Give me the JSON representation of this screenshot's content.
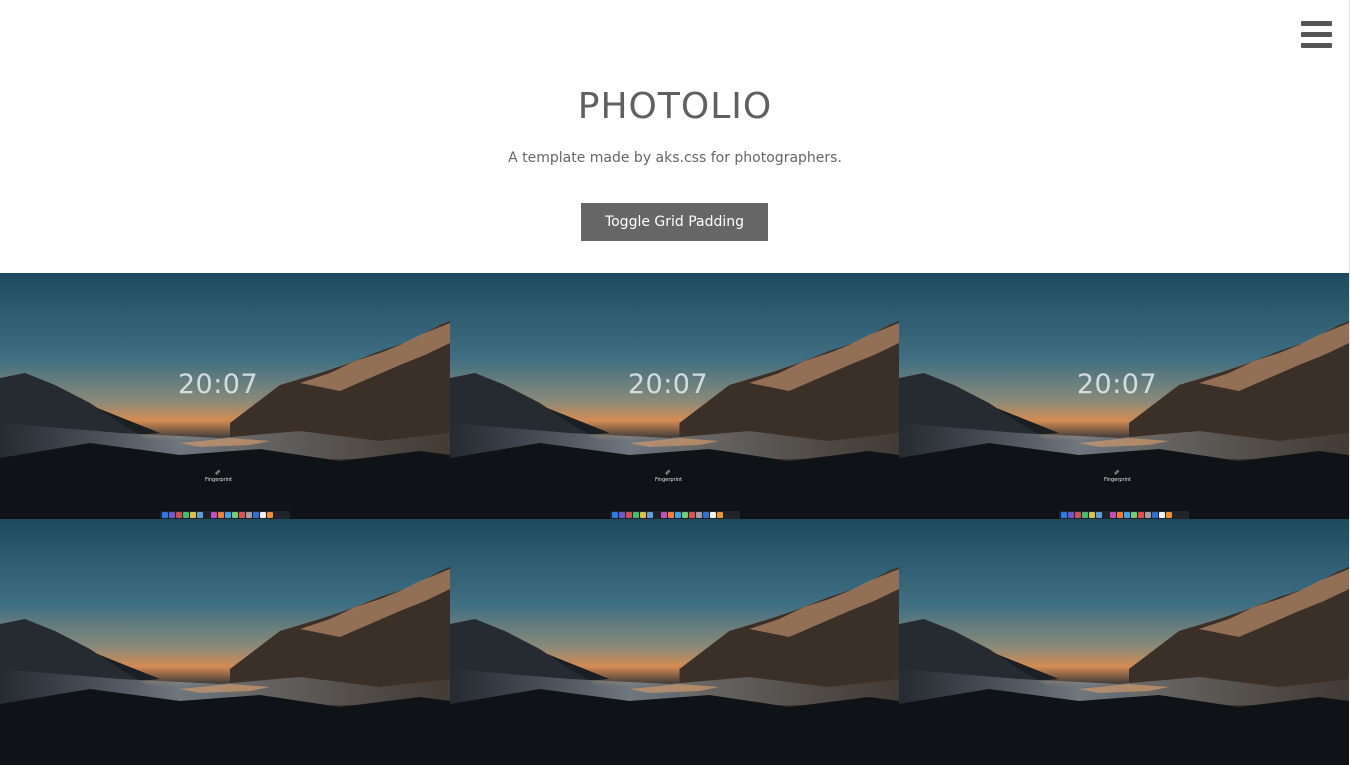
{
  "header": {
    "menu_icon": "hamburger-menu-icon",
    "title": "PHOTOLIO",
    "subtitle": "A template made by aks.css for photographers.",
    "toggle_label": "Toggle Grid Padding"
  },
  "gallery": {
    "photos": [
      {
        "clock": "20:07",
        "fingerprint_label": "Fingerprint"
      },
      {
        "clock": "20:07",
        "fingerprint_label": "Fingerprint"
      },
      {
        "clock": "20:07",
        "fingerprint_label": "Fingerprint"
      },
      {
        "clock": "",
        "fingerprint_label": ""
      },
      {
        "clock": "",
        "fingerprint_label": ""
      },
      {
        "clock": "",
        "fingerprint_label": ""
      }
    ]
  },
  "colors": {
    "button_bg": "#666666",
    "text": "#606060",
    "sky_top": "#1f4d63",
    "sky_glow": "#d9925a"
  }
}
